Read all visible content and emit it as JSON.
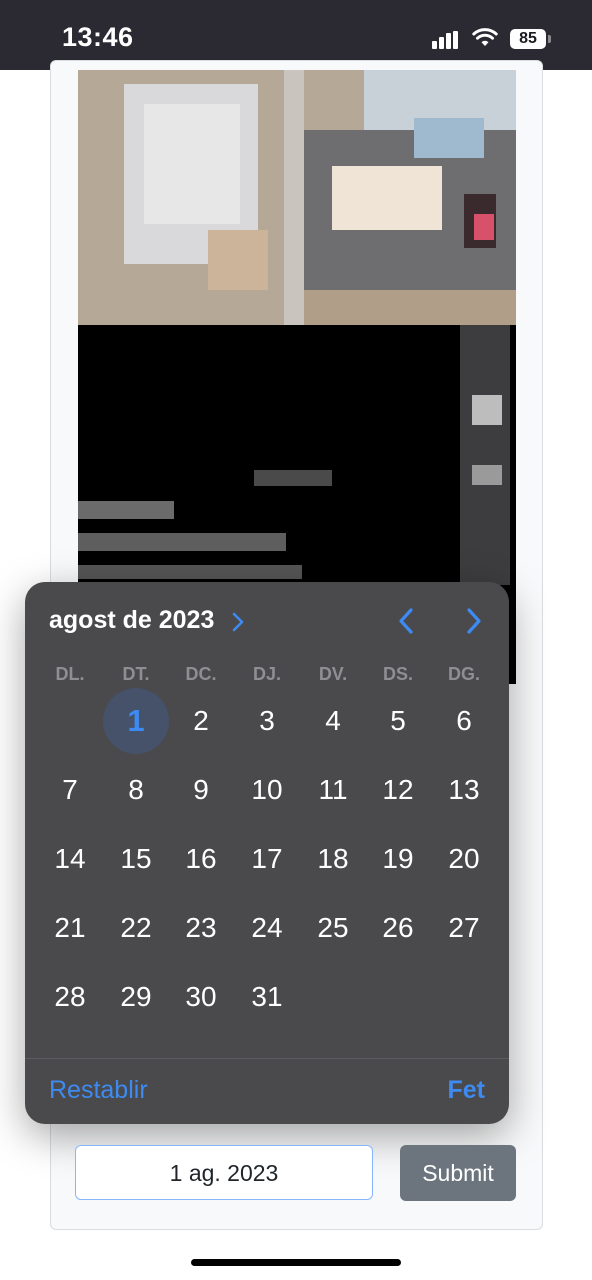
{
  "status_bar": {
    "time": "13:46",
    "battery": "85"
  },
  "calendar": {
    "month_label": "agost de 2023",
    "weekdays": [
      "DL.",
      "DT.",
      "DC.",
      "DJ.",
      "DV.",
      "DS.",
      "DG."
    ],
    "days": [
      "1",
      "2",
      "3",
      "4",
      "5",
      "6",
      "7",
      "8",
      "9",
      "10",
      "11",
      "12",
      "13",
      "14",
      "15",
      "16",
      "17",
      "18",
      "19",
      "20",
      "21",
      "22",
      "23",
      "24",
      "25",
      "26",
      "27",
      "28",
      "29",
      "30",
      "31"
    ],
    "selected_day": "1",
    "reset_label": "Restablir",
    "done_label": "Fet",
    "accent_color": "#3d8bf2"
  },
  "form": {
    "date_value": "1 ag. 2023",
    "submit_label": "Submit"
  },
  "icons": [
    "signal-icon",
    "wifi-icon",
    "battery-icon",
    "chevron-right-icon",
    "prev-month-icon",
    "next-month-icon"
  ]
}
